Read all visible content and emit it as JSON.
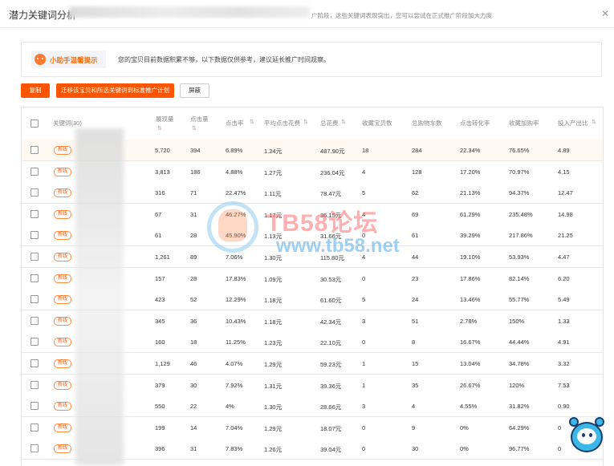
{
  "header": {
    "title": "潜力关键词分析",
    "tip": "广阶段，这些关键词表现突出，您可以尝试在正式推广阶段加大力度",
    "close_icon": "close-icon"
  },
  "notice": {
    "badge": "小助手温馨提示",
    "text": "您的宝贝目前数据积累不够，以下数据仅供参考，建议延长推广时间观察。"
  },
  "toolbar": {
    "copy_label": "复制",
    "move_label": "迁移该宝贝和所选关键词到标准推广计划",
    "shield_label": "屏蔽"
  },
  "table": {
    "headers": [
      "关键词(30)",
      "展现量",
      "点击量",
      "点击率",
      "平均点击花费",
      "总花费",
      "收藏宝贝数",
      "总购物车数",
      "点击转化率",
      "收藏加购率",
      "投入产出比"
    ],
    "sort_icon": "⇅",
    "tag_label": "新线",
    "rows": [
      [
        "5,720",
        "394",
        "6.89%",
        "1.24元",
        "487.90元",
        "18",
        "284",
        "22.34%",
        "76.65%",
        "4.89"
      ],
      [
        "3,813",
        "186",
        "4.88%",
        "1.27元",
        "236.04元",
        "4",
        "128",
        "17.20%",
        "70.97%",
        "4.15"
      ],
      [
        "316",
        "71",
        "22.47%",
        "1.11元",
        "78.47元",
        "5",
        "62",
        "21.13%",
        "94.37%",
        "12.47"
      ],
      [
        "67",
        "31",
        "46.27%",
        "1.17元",
        "36.15元",
        "4",
        "69",
        "61.29%",
        "235.48%",
        "14.98"
      ],
      [
        "61",
        "28",
        "45.90%",
        "1.13元",
        "31.66元",
        "0",
        "61",
        "39.29%",
        "217.86%",
        "21.25"
      ],
      [
        "1,261",
        "89",
        "7.06%",
        "1.30元",
        "115.80元",
        "4",
        "44",
        "19.10%",
        "53.93%",
        "4.47"
      ],
      [
        "157",
        "28",
        "17.83%",
        "1.09元",
        "30.53元",
        "0",
        "23",
        "17.86%",
        "82.14%",
        "6.20"
      ],
      [
        "423",
        "52",
        "12.29%",
        "1.18元",
        "61.60元",
        "5",
        "24",
        "13.46%",
        "55.77%",
        "5.49"
      ],
      [
        "345",
        "36",
        "10.43%",
        "1.18元",
        "42.34元",
        "3",
        "51",
        "2.78%",
        "150%",
        "1.33"
      ],
      [
        "160",
        "18",
        "11.25%",
        "1.23元",
        "22.10元",
        "0",
        "8",
        "16.67%",
        "44.44%",
        "4.91"
      ],
      [
        "1,129",
        "46",
        "4.07%",
        "1.29元",
        "59.23元",
        "1",
        "15",
        "13.04%",
        "34.78%",
        "3.32"
      ],
      [
        "379",
        "30",
        "7.92%",
        "1.31元",
        "39.36元",
        "1",
        "35",
        "26.67%",
        "120%",
        "7.53"
      ],
      [
        "550",
        "22",
        "4%",
        "1.30元",
        "28.66元",
        "3",
        "4",
        "4.55%",
        "31.82%",
        "0.90"
      ],
      [
        "199",
        "14",
        "7.04%",
        "1.29元",
        "18.07元",
        "0",
        "9",
        "0%",
        "64.29%",
        "0"
      ],
      [
        "396",
        "31",
        "7.83%",
        "1.26元",
        "39.04元",
        "0",
        "30",
        "0%",
        "96.77%",
        "0"
      ]
    ]
  },
  "watermark": {
    "brand": "TB58论坛",
    "url": "www.tb58.net"
  },
  "colors": {
    "accent": "#ff5500",
    "highlight_row": "#fff9f2"
  }
}
